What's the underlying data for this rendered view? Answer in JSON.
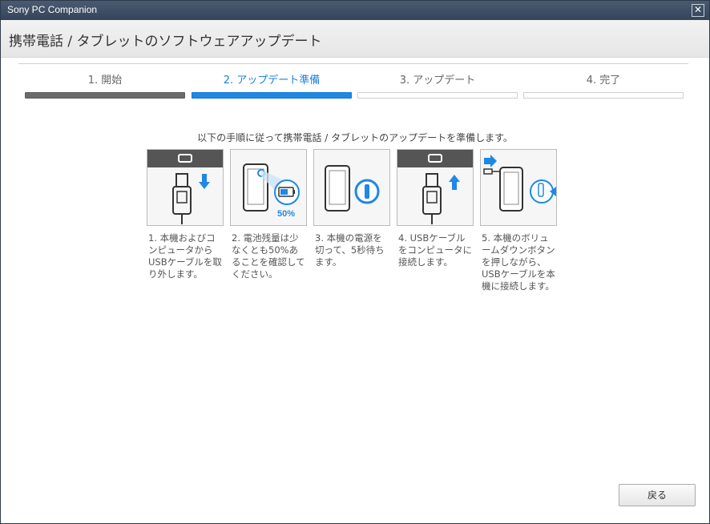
{
  "window": {
    "title": "Sony PC Companion",
    "close_icon": "close-icon"
  },
  "header": {
    "title": "携帯電話 / タブレットのソフトウェアアップデート"
  },
  "steps": [
    {
      "label": "1. 開始",
      "state": "done"
    },
    {
      "label": "2. アップデート準備",
      "state": "active"
    },
    {
      "label": "3. アップデート",
      "state": "pending"
    },
    {
      "label": "4. 完了",
      "state": "pending"
    }
  ],
  "instruction": "以下の手順に従って携帯電話 / タブレットのアップデートを準備します。",
  "cards": [
    {
      "icon": "usb-unplug-icon",
      "caption": "1. 本機およびコンピュータからUSBケーブルを取り外します。"
    },
    {
      "icon": "battery-check-icon",
      "caption": "2. 電池残量は少なくとも50%あることを確認してください。",
      "badge": "50%"
    },
    {
      "icon": "power-off-icon",
      "caption": "3. 本機の電源を切って、5秒待ちます。"
    },
    {
      "icon": "usb-plug-icon",
      "caption": "4. USBケーブルをコンピュータに接続します。"
    },
    {
      "icon": "volume-button-connect-icon",
      "caption": "5. 本機のボリュームダウンボタンを押しながら、USBケーブルを本機に接続します。"
    }
  ],
  "colors": {
    "accent": "#1e88e5",
    "done": "#6b6b6b"
  },
  "footer": {
    "back_label": "戻る"
  }
}
